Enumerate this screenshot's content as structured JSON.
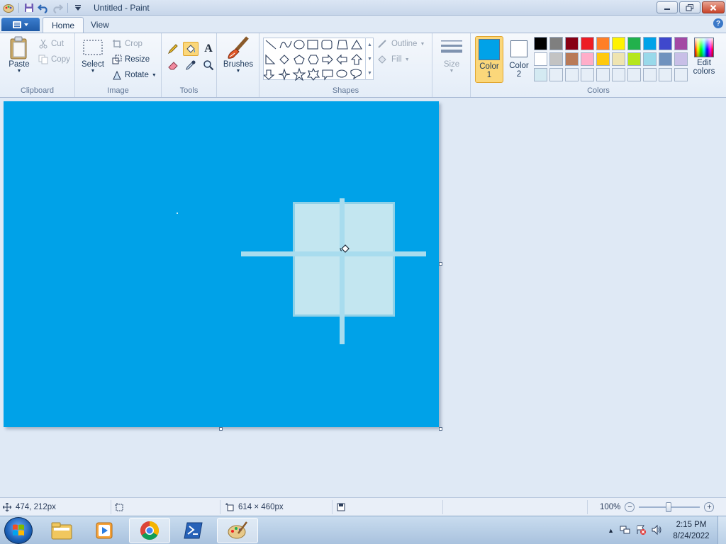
{
  "window": {
    "title": "Untitled - Paint"
  },
  "tabs": {
    "home": "Home",
    "view": "View"
  },
  "clipboard": {
    "label": "Clipboard",
    "paste": "Paste",
    "cut": "Cut",
    "copy": "Copy"
  },
  "image": {
    "label": "Image",
    "select": "Select",
    "crop": "Crop",
    "resize": "Resize",
    "rotate": "Rotate"
  },
  "tools": {
    "label": "Tools"
  },
  "brushes": {
    "label": "Brushes"
  },
  "shapes": {
    "label": "Shapes",
    "outline": "Outline",
    "fill": "Fill",
    "size": "Size"
  },
  "colors": {
    "label": "Colors",
    "color1_line1": "Color",
    "color1_line2": "1",
    "color2_line1": "Color",
    "color2_line2": "2",
    "edit_line1": "Edit",
    "edit_line2": "colors",
    "color1": "#00a2e8",
    "color2": "#ffffff",
    "palette_row1": [
      "#000000",
      "#7f7f7f",
      "#880015",
      "#ed1c24",
      "#ff7f27",
      "#fff200",
      "#22b14c",
      "#00a2e8",
      "#3f48cc",
      "#a349a4"
    ],
    "palette_row2": [
      "#ffffff",
      "#c3c3c3",
      "#b97a57",
      "#ffaec9",
      "#ffc90e",
      "#efe4b0",
      "#b5e61d",
      "#99d9ea",
      "#7092be",
      "#c8bfe7"
    ],
    "palette_row3": [
      "#d4eaf2",
      "#e6eef7",
      "#e6eef7",
      "#e6eef7",
      "#e6eef7",
      "#e6eef7",
      "#e6eef7",
      "#e6eef7",
      "#e6eef7",
      "#e6eef7"
    ]
  },
  "status": {
    "cursor_pos": "474, 212px",
    "canvas_size": "614 × 460px",
    "zoom": "100%"
  },
  "taskbar": {
    "time": "2:15 PM",
    "date": "8/24/2022"
  }
}
